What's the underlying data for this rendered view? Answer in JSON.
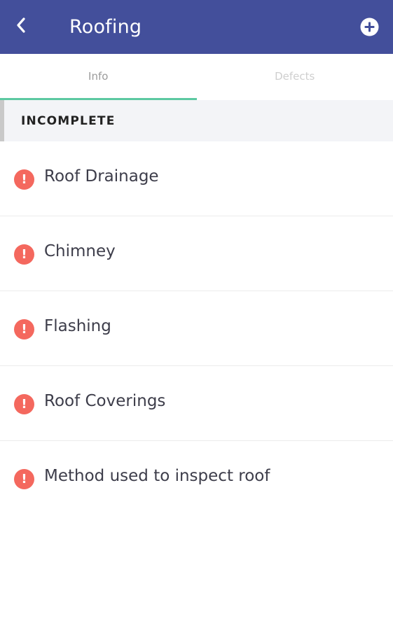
{
  "header": {
    "title": "Roofing",
    "back_icon": "chevron-left-icon",
    "add_icon": "plus-circle-icon",
    "background_color": "#434f9b"
  },
  "tabs": [
    {
      "label": "Info",
      "active": true
    },
    {
      "label": "Defects",
      "active": false
    }
  ],
  "tab_indicator_color": "#5cc9a1",
  "section": {
    "title": "INCOMPLETE"
  },
  "items": [
    {
      "label": "Roof Drainage",
      "status_icon": "alert-icon",
      "status_symbol": "!"
    },
    {
      "label": "Chimney",
      "status_icon": "alert-icon",
      "status_symbol": "!"
    },
    {
      "label": "Flashing",
      "status_icon": "alert-icon",
      "status_symbol": "!"
    },
    {
      "label": "Roof Coverings",
      "status_icon": "alert-icon",
      "status_symbol": "!"
    },
    {
      "label": "Method used to inspect roof",
      "status_icon": "alert-icon",
      "status_symbol": "!"
    }
  ],
  "alert_color": "#f4685e"
}
